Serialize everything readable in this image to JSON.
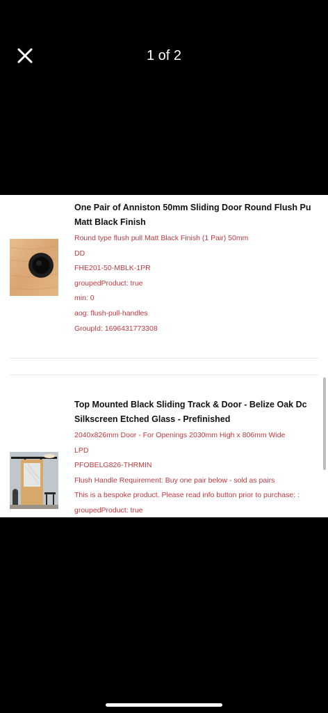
{
  "header": {
    "close_icon": "close-icon",
    "counter": "1 of 2"
  },
  "products": [
    {
      "title_line1": "One Pair of Anniston 50mm Sliding Door Round Flush Pu",
      "title_line2": "Matt Black Finish",
      "details": [
        "Round type flush pull Matt Black Finish (1 Pair) 50mm",
        "DD",
        "FHE201-50-MBLK-1PR",
        "groupedProduct: true",
        "min: 0",
        "aog: flush-pull-handles",
        "GroupId: 1696431773308"
      ]
    },
    {
      "title_line1": "Top Mounted Black Sliding Track & Door - Belize Oak Dc",
      "title_line2": "Silkscreen Etched Glass - Prefinished",
      "details": [
        "2040x826mm Door - For Openings 2030mm High x 806mm Wide",
        "LPD",
        "PFOBELG826-THRMIN",
        "Flush Handle Requirement: Buy one pair below - sold as pairs",
        "This is a bespoke product. Please read info button prior to purchase: :",
        "groupedProduct: true"
      ]
    }
  ],
  "colors": {
    "background": "#000000",
    "sheet": "#ffffff",
    "detail_text": "#c0393f",
    "title_text": "#111111"
  }
}
